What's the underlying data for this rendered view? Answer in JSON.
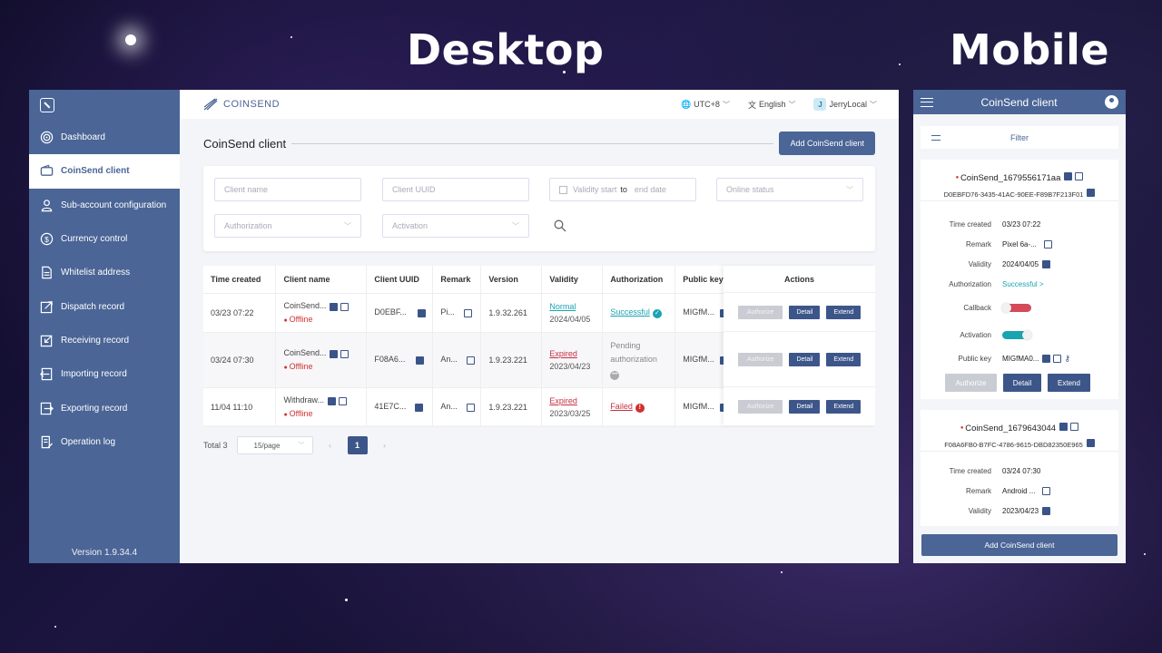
{
  "headings": {
    "desktop": "Desktop",
    "mobile": "Mobile"
  },
  "sidebar": {
    "version": "Version 1.9.34.4",
    "items": [
      {
        "label": "Dashboard",
        "icon": "dashboard-icon"
      },
      {
        "label": "CoinSend client",
        "icon": "wallet-icon",
        "active": true
      },
      {
        "label": "Sub-account configuration",
        "icon": "user-icon"
      },
      {
        "label": "Currency control",
        "icon": "dollar-icon"
      },
      {
        "label": "Whitelist address",
        "icon": "document-icon"
      },
      {
        "label": "Dispatch record",
        "icon": "send-out-icon"
      },
      {
        "label": "Receiving record",
        "icon": "receive-in-icon"
      },
      {
        "label": "Importing record",
        "icon": "import-icon"
      },
      {
        "label": "Exporting record",
        "icon": "export-icon"
      },
      {
        "label": "Operation log",
        "icon": "log-icon"
      }
    ]
  },
  "topbar": {
    "logo": "COINSEND",
    "timezone": "UTC+8",
    "language": "English",
    "user_initial": "J",
    "user": "JerryLocal"
  },
  "page": {
    "title": "CoinSend client",
    "add_button": "Add CoinSend client"
  },
  "filters": {
    "client_name": "Client name",
    "client_uuid": "Client UUID",
    "validity_start": "Validity start",
    "validity_to": "to",
    "validity_end": "end date",
    "online_status": "Online status",
    "authorization": "Authorization",
    "activation": "Activation"
  },
  "table": {
    "headers": [
      "Time created",
      "Client name",
      "Client UUID",
      "Remark",
      "Version",
      "Validity",
      "Authorization",
      "Public key"
    ],
    "actions_header": "Actions",
    "rows": [
      {
        "time": "03/23 07:22",
        "name": "CoinSend...",
        "status": "Offline",
        "uuid": "D0EBF...",
        "remark": "Pi...",
        "version": "1.9.32.261",
        "validity": "Normal",
        "validity_date": "2024/04/05",
        "auth": "Successful",
        "pubkey": "MIGfM..."
      },
      {
        "time": "03/24 07:30",
        "name": "CoinSend...",
        "status": "Offline",
        "uuid": "F08A6...",
        "remark": "An...",
        "version": "1.9.23.221",
        "validity": "Expired",
        "validity_date": "2023/04/23",
        "auth_line1": "Pending",
        "auth_line2": "authorization",
        "pubkey": "MIGfM..."
      },
      {
        "time": "11/04 11:10",
        "name": "Withdraw...",
        "status": "Offline",
        "uuid": "41E7C...",
        "remark": "An...",
        "version": "1.9.23.221",
        "validity": "Expired",
        "validity_date": "2023/03/25",
        "auth": "Failed",
        "pubkey": "MIGfM..."
      }
    ],
    "btn_authorize": "Authorize",
    "btn_detail": "Detail",
    "btn_extend": "Extend"
  },
  "pager": {
    "total": "Total 3",
    "page_size": "15/page",
    "current": "1"
  },
  "mobile": {
    "title": "CoinSend client",
    "filter": "Filter",
    "card1": {
      "name": "CoinSend_1679556171aa",
      "uuid": "D0EBFD76-3435-41AC-90EE-F89B7F213F01",
      "time_k": "Time created",
      "time_v": "03/23 07:22",
      "remark_k": "Remark",
      "remark_v": "Pixel 6a-...",
      "validity_k": "Validity",
      "validity_v": "2024/04/05",
      "auth_k": "Authorization",
      "auth_v": "Successful >",
      "callback_k": "Callback",
      "activation_k": "Activation",
      "pubkey_k": "Public key",
      "pubkey_v": "MIGfMA0..."
    },
    "card2": {
      "name": "CoinSend_1679643044",
      "uuid": "F08A6FB0-B7FC-4786-9615-DBD82350E965",
      "time_k": "Time created",
      "time_v": "03/24 07:30",
      "remark_k": "Remark",
      "remark_v": "Android ...",
      "validity_k": "Validity",
      "validity_v": "2023/04/23"
    },
    "add_button": "Add CoinSend client"
  },
  "colors": {
    "primary": "#4a6596",
    "teal": "#1aa3b0",
    "red": "#d03030"
  }
}
